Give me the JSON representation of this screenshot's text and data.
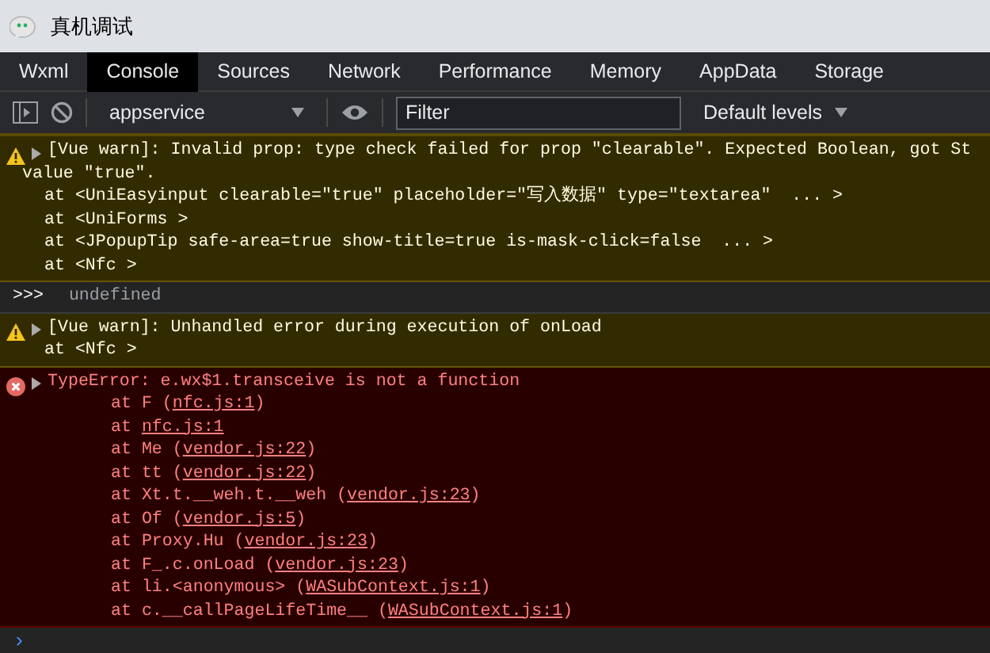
{
  "window": {
    "title": "真机调试"
  },
  "tabs": [
    {
      "label": "Wxml",
      "selected": false
    },
    {
      "label": "Console",
      "selected": true
    },
    {
      "label": "Sources",
      "selected": false
    },
    {
      "label": "Network",
      "selected": false
    },
    {
      "label": "Performance",
      "selected": false
    },
    {
      "label": "Memory",
      "selected": false
    },
    {
      "label": "AppData",
      "selected": false
    },
    {
      "label": "Storage",
      "selected": false
    }
  ],
  "toolbar": {
    "context": "appservice",
    "filter": {
      "placeholder": "Filter"
    },
    "levels": "Default levels"
  },
  "messages": [
    {
      "kind": "warning",
      "lines": [
        "[Vue warn]: Invalid prop: type check failed for prop \"clearable\". Expected Boolean, got St",
        "value \"true\"."
      ],
      "trace": [
        "at <UniEasyinput clearable=\"true\" placeholder=\"写入数据\" type=\"textarea\"  ... >",
        "at <UniForms >",
        "at <JPopupTip safe-area=true show-title=true is-mask-click=false  ... >",
        "at <Nfc >"
      ]
    },
    {
      "kind": "result",
      "prompt": ">>>",
      "text": "undefined"
    },
    {
      "kind": "warning",
      "lines": [
        "[Vue warn]: Unhandled error during execution of onLoad"
      ],
      "trace": [
        "at <Nfc >"
      ]
    },
    {
      "kind": "error",
      "text": "TypeError: e.wx$1.transceive is not a function",
      "stack": [
        {
          "before": "at F (",
          "link": "nfc.js:1",
          "after": ")"
        },
        {
          "before": "at ",
          "link": "nfc.js:1"
        },
        {
          "before": "at Me (",
          "link": "vendor.js:22",
          "after": ")"
        },
        {
          "before": "at tt (",
          "link": "vendor.js:22",
          "after": ")"
        },
        {
          "before": "at Xt.t.__weh.t.__weh (",
          "link": "vendor.js:23",
          "after": ")"
        },
        {
          "before": "at Of (",
          "link": "vendor.js:5",
          "after": ")"
        },
        {
          "before": "at Proxy.Hu (",
          "link": "vendor.js:23",
          "after": ")"
        },
        {
          "before": "at F_.c.onLoad (",
          "link": "vendor.js:23",
          "after": ")"
        },
        {
          "before": "at li.<anonymous> (",
          "link": "WASubContext.js:1",
          "after": ")"
        },
        {
          "before": "at c.__callPageLifeTime__ (",
          "link": "WASubContext.js:1",
          "after": ")"
        }
      ]
    }
  ],
  "prompt": {
    "symbol": "›"
  }
}
